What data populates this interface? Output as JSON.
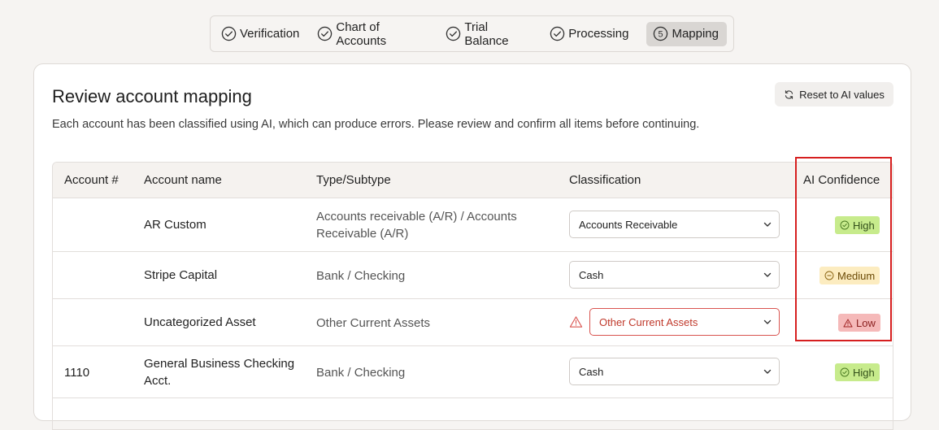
{
  "stepper": {
    "steps": [
      {
        "label": "Verification",
        "state": "complete"
      },
      {
        "label": "Chart of Accounts",
        "state": "complete"
      },
      {
        "label": "Trial Balance",
        "state": "complete"
      },
      {
        "label": "Processing",
        "state": "complete"
      },
      {
        "label": "Mapping",
        "state": "active",
        "number": "5"
      }
    ]
  },
  "page": {
    "title": "Review account mapping",
    "subtitle": "Each account has been classified using AI, which can produce errors. Please review and confirm all items before continuing.",
    "reset_label": "Reset to AI values"
  },
  "table": {
    "headers": {
      "account_no": "Account #",
      "account_name": "Account name",
      "type": "Type/Subtype",
      "classification": "Classification",
      "confidence": "AI Confidence"
    },
    "rows": [
      {
        "account_no": "",
        "name": "AR Custom",
        "type_line1": "Accounts receivable (A/R) / Accounts",
        "type_line2": "Receivable (A/R)",
        "classification": "Accounts Receivable",
        "confidence": "High",
        "warning": false
      },
      {
        "account_no": "",
        "name": "Stripe Capital",
        "type_line1": "Bank / Checking",
        "type_line2": "",
        "classification": "Cash",
        "confidence": "Medium",
        "warning": false
      },
      {
        "account_no": "",
        "name": "Uncategorized Asset",
        "type_line1": "Other Current Assets",
        "type_line2": "",
        "classification": "Other Current Assets",
        "confidence": "Low",
        "warning": true
      },
      {
        "account_no": "1110",
        "name_line1": "General Business Checking",
        "name_line2": "Acct.",
        "type_line1": "Bank / Checking",
        "type_line2": "",
        "classification": "Cash",
        "confidence": "High",
        "warning": false
      }
    ]
  },
  "colors": {
    "high": "#c7eb8c",
    "medium": "#fcecc0",
    "low": "#f5b9b9",
    "highlight_box": "#d61f1f",
    "error": "#d9534f"
  }
}
